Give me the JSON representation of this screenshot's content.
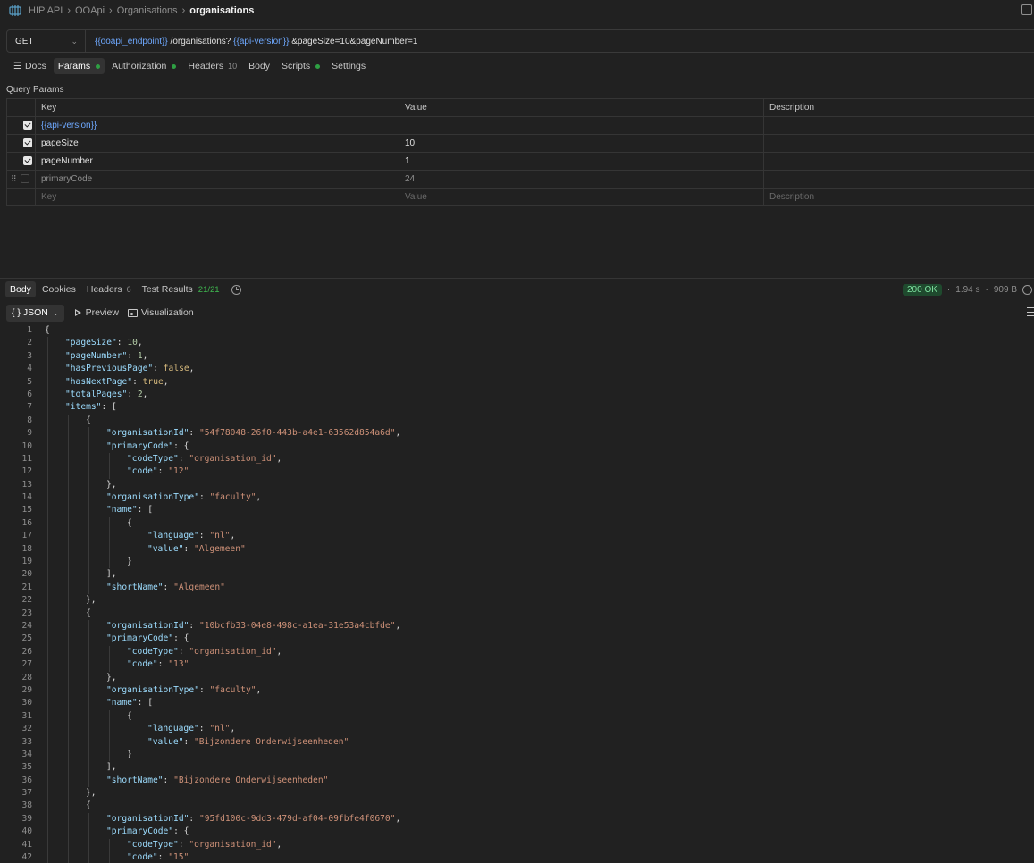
{
  "breadcrumb": {
    "items": [
      "HIP API",
      "OOApi",
      "Organisations"
    ],
    "current": "organisations"
  },
  "request": {
    "method": "GET",
    "url_parts": [
      {
        "text": "{{ooapi_endpoint}}",
        "var": true
      },
      {
        "text": " /organisations? ",
        "var": false
      },
      {
        "text": "{{api-version}}",
        "var": true
      },
      {
        "text": " &pageSize=10&pageNumber=1",
        "var": false
      }
    ]
  },
  "request_tabs": [
    {
      "label": "Docs",
      "active": false,
      "dot": false,
      "count": ""
    },
    {
      "label": "Params",
      "active": true,
      "dot": true,
      "count": ""
    },
    {
      "label": "Authorization",
      "active": false,
      "dot": true,
      "count": ""
    },
    {
      "label": "Headers",
      "active": false,
      "dot": false,
      "count": "10"
    },
    {
      "label": "Body",
      "active": false,
      "dot": false,
      "count": ""
    },
    {
      "label": "Scripts",
      "active": false,
      "dot": true,
      "count": ""
    },
    {
      "label": "Settings",
      "active": false,
      "dot": false,
      "count": ""
    }
  ],
  "query_params": {
    "label": "Query Params",
    "headers": {
      "key": "Key",
      "value": "Value",
      "description": "Description"
    },
    "rows": [
      {
        "checked": true,
        "key": "{{api-version}}",
        "key_is_var": true,
        "value": "",
        "description": ""
      },
      {
        "checked": true,
        "key": "pageSize",
        "key_is_var": false,
        "value": "10",
        "description": ""
      },
      {
        "checked": true,
        "key": "pageNumber",
        "key_is_var": false,
        "value": "1",
        "description": ""
      },
      {
        "checked": false,
        "key": "primaryCode",
        "key_is_var": false,
        "value": "24",
        "description": ""
      }
    ],
    "placeholder": {
      "key": "Key",
      "value": "Value",
      "description": "Description"
    }
  },
  "response_tabs": [
    {
      "label": "Body",
      "active": true,
      "count": "",
      "green": false
    },
    {
      "label": "Cookies",
      "active": false,
      "count": "",
      "green": false
    },
    {
      "label": "Headers",
      "active": false,
      "count": "6",
      "green": false
    },
    {
      "label": "Test Results",
      "active": false,
      "count": "21/21",
      "green": true
    }
  ],
  "response_status": {
    "status": "200 OK",
    "time": "1.94 s",
    "size": "909 B"
  },
  "view_options": {
    "format": "{ } JSON",
    "preview": "Preview",
    "visualization": "Visualization"
  },
  "code_lines": [
    {
      "n": "1",
      "indent": 0,
      "tokens": [
        [
          "p",
          "{"
        ]
      ]
    },
    {
      "n": "2",
      "indent": 1,
      "tokens": [
        [
          "k",
          "\"pageSize\""
        ],
        [
          "p",
          ": "
        ],
        [
          "n",
          "10"
        ],
        [
          "p",
          ","
        ]
      ]
    },
    {
      "n": "3",
      "indent": 1,
      "tokens": [
        [
          "k",
          "\"pageNumber\""
        ],
        [
          "p",
          ": "
        ],
        [
          "n",
          "1"
        ],
        [
          "p",
          ","
        ]
      ]
    },
    {
      "n": "4",
      "indent": 1,
      "tokens": [
        [
          "k",
          "\"hasPreviousPage\""
        ],
        [
          "p",
          ": "
        ],
        [
          "b",
          "false"
        ],
        [
          "p",
          ","
        ]
      ]
    },
    {
      "n": "5",
      "indent": 1,
      "tokens": [
        [
          "k",
          "\"hasNextPage\""
        ],
        [
          "p",
          ": "
        ],
        [
          "b",
          "true"
        ],
        [
          "p",
          ","
        ]
      ]
    },
    {
      "n": "6",
      "indent": 1,
      "tokens": [
        [
          "k",
          "\"totalPages\""
        ],
        [
          "p",
          ": "
        ],
        [
          "n",
          "2"
        ],
        [
          "p",
          ","
        ]
      ]
    },
    {
      "n": "7",
      "indent": 1,
      "tokens": [
        [
          "k",
          "\"items\""
        ],
        [
          "p",
          ": ["
        ]
      ]
    },
    {
      "n": "8",
      "indent": 2,
      "tokens": [
        [
          "p",
          "{"
        ]
      ]
    },
    {
      "n": "9",
      "indent": 3,
      "tokens": [
        [
          "k",
          "\"organisationId\""
        ],
        [
          "p",
          ": "
        ],
        [
          "s",
          "\"54f78048-26f0-443b-a4e1-63562d854a6d\""
        ],
        [
          "p",
          ","
        ]
      ]
    },
    {
      "n": "10",
      "indent": 3,
      "tokens": [
        [
          "k",
          "\"primaryCode\""
        ],
        [
          "p",
          ": {"
        ]
      ]
    },
    {
      "n": "11",
      "indent": 4,
      "tokens": [
        [
          "k",
          "\"codeType\""
        ],
        [
          "p",
          ": "
        ],
        [
          "s",
          "\"organisation_id\""
        ],
        [
          "p",
          ","
        ]
      ]
    },
    {
      "n": "12",
      "indent": 4,
      "tokens": [
        [
          "k",
          "\"code\""
        ],
        [
          "p",
          ": "
        ],
        [
          "s",
          "\"12\""
        ]
      ]
    },
    {
      "n": "13",
      "indent": 3,
      "tokens": [
        [
          "p",
          "},"
        ]
      ]
    },
    {
      "n": "14",
      "indent": 3,
      "tokens": [
        [
          "k",
          "\"organisationType\""
        ],
        [
          "p",
          ": "
        ],
        [
          "s",
          "\"faculty\""
        ],
        [
          "p",
          ","
        ]
      ]
    },
    {
      "n": "15",
      "indent": 3,
      "tokens": [
        [
          "k",
          "\"name\""
        ],
        [
          "p",
          ": ["
        ]
      ]
    },
    {
      "n": "16",
      "indent": 4,
      "tokens": [
        [
          "p",
          "{"
        ]
      ]
    },
    {
      "n": "17",
      "indent": 5,
      "tokens": [
        [
          "k",
          "\"language\""
        ],
        [
          "p",
          ": "
        ],
        [
          "s",
          "\"nl\""
        ],
        [
          "p",
          ","
        ]
      ]
    },
    {
      "n": "18",
      "indent": 5,
      "tokens": [
        [
          "k",
          "\"value\""
        ],
        [
          "p",
          ": "
        ],
        [
          "s",
          "\"Algemeen\""
        ]
      ]
    },
    {
      "n": "19",
      "indent": 4,
      "tokens": [
        [
          "p",
          "}"
        ]
      ]
    },
    {
      "n": "20",
      "indent": 3,
      "tokens": [
        [
          "p",
          "],"
        ]
      ]
    },
    {
      "n": "21",
      "indent": 3,
      "tokens": [
        [
          "k",
          "\"shortName\""
        ],
        [
          "p",
          ": "
        ],
        [
          "s",
          "\"Algemeen\""
        ]
      ]
    },
    {
      "n": "22",
      "indent": 2,
      "tokens": [
        [
          "p",
          "},"
        ]
      ]
    },
    {
      "n": "23",
      "indent": 2,
      "tokens": [
        [
          "p",
          "{"
        ]
      ]
    },
    {
      "n": "24",
      "indent": 3,
      "tokens": [
        [
          "k",
          "\"organisationId\""
        ],
        [
          "p",
          ": "
        ],
        [
          "s",
          "\"10bcfb33-04e8-498c-a1ea-31e53a4cbfde\""
        ],
        [
          "p",
          ","
        ]
      ]
    },
    {
      "n": "25",
      "indent": 3,
      "tokens": [
        [
          "k",
          "\"primaryCode\""
        ],
        [
          "p",
          ": {"
        ]
      ]
    },
    {
      "n": "26",
      "indent": 4,
      "tokens": [
        [
          "k",
          "\"codeType\""
        ],
        [
          "p",
          ": "
        ],
        [
          "s",
          "\"organisation_id\""
        ],
        [
          "p",
          ","
        ]
      ]
    },
    {
      "n": "27",
      "indent": 4,
      "tokens": [
        [
          "k",
          "\"code\""
        ],
        [
          "p",
          ": "
        ],
        [
          "s",
          "\"13\""
        ]
      ]
    },
    {
      "n": "28",
      "indent": 3,
      "tokens": [
        [
          "p",
          "},"
        ]
      ]
    },
    {
      "n": "29",
      "indent": 3,
      "tokens": [
        [
          "k",
          "\"organisationType\""
        ],
        [
          "p",
          ": "
        ],
        [
          "s",
          "\"faculty\""
        ],
        [
          "p",
          ","
        ]
      ]
    },
    {
      "n": "30",
      "indent": 3,
      "tokens": [
        [
          "k",
          "\"name\""
        ],
        [
          "p",
          ": ["
        ]
      ]
    },
    {
      "n": "31",
      "indent": 4,
      "tokens": [
        [
          "p",
          "{"
        ]
      ]
    },
    {
      "n": "32",
      "indent": 5,
      "tokens": [
        [
          "k",
          "\"language\""
        ],
        [
          "p",
          ": "
        ],
        [
          "s",
          "\"nl\""
        ],
        [
          "p",
          ","
        ]
      ]
    },
    {
      "n": "33",
      "indent": 5,
      "tokens": [
        [
          "k",
          "\"value\""
        ],
        [
          "p",
          ": "
        ],
        [
          "s",
          "\"Bijzondere Onderwijseenheden\""
        ]
      ]
    },
    {
      "n": "34",
      "indent": 4,
      "tokens": [
        [
          "p",
          "}"
        ]
      ]
    },
    {
      "n": "35",
      "indent": 3,
      "tokens": [
        [
          "p",
          "],"
        ]
      ]
    },
    {
      "n": "36",
      "indent": 3,
      "tokens": [
        [
          "k",
          "\"shortName\""
        ],
        [
          "p",
          ": "
        ],
        [
          "s",
          "\"Bijzondere Onderwijseenheden\""
        ]
      ]
    },
    {
      "n": "37",
      "indent": 2,
      "tokens": [
        [
          "p",
          "},"
        ]
      ]
    },
    {
      "n": "38",
      "indent": 2,
      "tokens": [
        [
          "p",
          "{"
        ]
      ]
    },
    {
      "n": "39",
      "indent": 3,
      "tokens": [
        [
          "k",
          "\"organisationId\""
        ],
        [
          "p",
          ": "
        ],
        [
          "s",
          "\"95fd100c-9dd3-479d-af04-09fbfe4f0670\""
        ],
        [
          "p",
          ","
        ]
      ]
    },
    {
      "n": "40",
      "indent": 3,
      "tokens": [
        [
          "k",
          "\"primaryCode\""
        ],
        [
          "p",
          ": {"
        ]
      ]
    },
    {
      "n": "41",
      "indent": 4,
      "tokens": [
        [
          "k",
          "\"codeType\""
        ],
        [
          "p",
          ": "
        ],
        [
          "s",
          "\"organisation_id\""
        ],
        [
          "p",
          ","
        ]
      ]
    },
    {
      "n": "42",
      "indent": 4,
      "tokens": [
        [
          "k",
          "\"code\""
        ],
        [
          "p",
          ": "
        ],
        [
          "s",
          "\"15\""
        ]
      ]
    }
  ]
}
